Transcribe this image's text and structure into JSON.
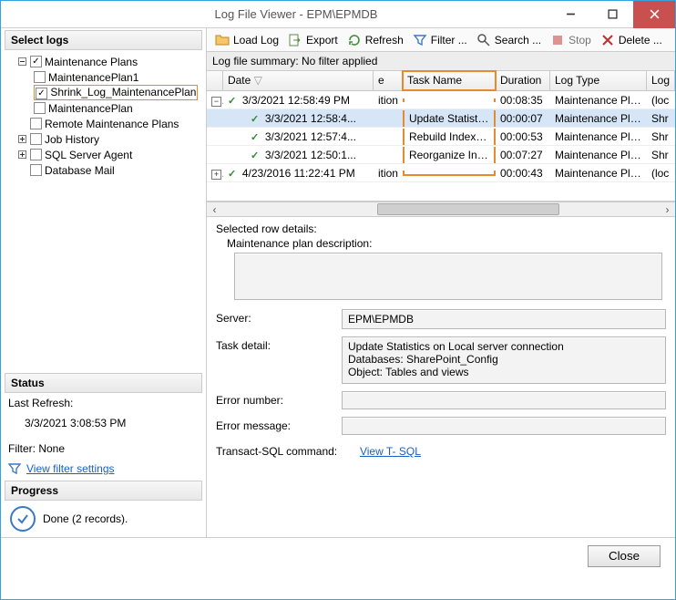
{
  "window": {
    "title": "Log File Viewer - EPM\\EPMDB"
  },
  "toolbar": {
    "loadlog": "Load Log",
    "export": "Export",
    "refresh": "Refresh",
    "filter": "Filter ...",
    "search": "Search ...",
    "stop": "Stop",
    "delete": "Delete ..."
  },
  "left": {
    "select_logs_hdr": "Select logs",
    "tree": {
      "maintenance_plans": "Maintenance Plans",
      "maintenance_plan1": "MaintenancePlan1",
      "shrink_log": "Shrink_Log_MaintenancePlan",
      "maintenance_plan": "MaintenancePlan",
      "remote": "Remote Maintenance Plans",
      "job_history": "Job History",
      "sql_agent": "SQL Server Agent",
      "db_mail": "Database Mail"
    },
    "status_hdr": "Status",
    "last_refresh_label": "Last Refresh:",
    "last_refresh_value": "3/3/2021 3:08:53 PM",
    "filter_label": "Filter: None",
    "view_filter_link": "View filter settings",
    "progress_hdr": "Progress",
    "progress_text": "Done (2 records)."
  },
  "grid": {
    "summary": "Log file summary: No filter applied",
    "headers": {
      "date": "Date",
      "col2": "e",
      "task": "Task Name",
      "duration": "Duration",
      "logtype": "Log Type",
      "logsrc": "Log"
    },
    "rows": [
      {
        "exp": "minus",
        "ok": true,
        "date": "3/3/2021 12:58:49 PM",
        "col2": "ition",
        "task": "",
        "duration": "00:08:35",
        "logtype": "Maintenance Plans",
        "logsrc": "(loc",
        "sel": false
      },
      {
        "exp": "",
        "ok": true,
        "date": "3/3/2021 12:58:4...",
        "col2": "",
        "task": "Update Statisti...",
        "duration": "00:00:07",
        "logtype": "Maintenance Plans",
        "logsrc": "Shr",
        "sel": true
      },
      {
        "exp": "",
        "ok": true,
        "date": "3/3/2021 12:57:4...",
        "col2": "",
        "task": "Rebuild Index (...",
        "duration": "00:00:53",
        "logtype": "Maintenance Plans",
        "logsrc": "Shr",
        "sel": false
      },
      {
        "exp": "",
        "ok": true,
        "date": "3/3/2021 12:50:1...",
        "col2": "",
        "task": "Reorganize Ind...",
        "duration": "00:07:27",
        "logtype": "Maintenance Plans",
        "logsrc": "Shr",
        "sel": false
      },
      {
        "exp": "plus",
        "ok": true,
        "date": "4/23/2016 11:22:41 PM",
        "col2": "ition",
        "task": "",
        "duration": "00:00:43",
        "logtype": "Maintenance Plans",
        "logsrc": "(loc",
        "sel": false
      }
    ]
  },
  "details": {
    "header": "Selected row details:",
    "plan_desc_lbl": "Maintenance plan description:",
    "server_lbl": "Server:",
    "server_val": "EPM\\EPMDB",
    "task_lbl": "Task detail:",
    "task_val": "Update Statistics on Local server connection\nDatabases: SharePoint_Config\nObject: Tables and views",
    "err_num_lbl": "Error number:",
    "err_msg_lbl": "Error message:",
    "tsql_lbl": "Transact-SQL command:",
    "tsql_link": "View T- SQL"
  },
  "bottom": {
    "close": "Close"
  }
}
